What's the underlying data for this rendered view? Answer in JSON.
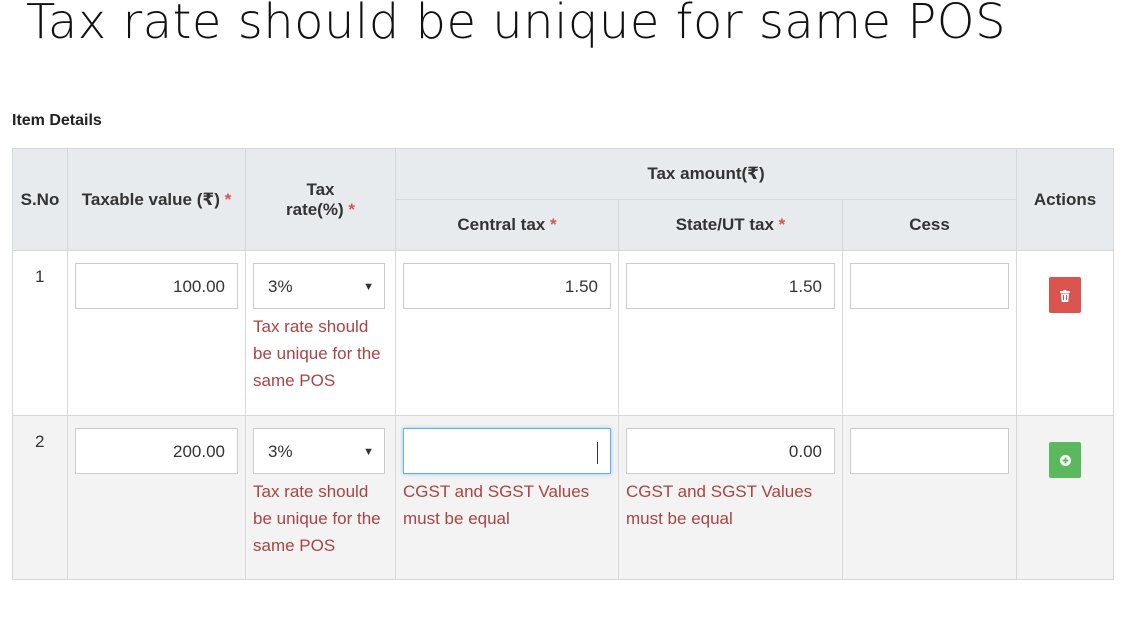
{
  "slide": {
    "title": "Tax rate should be unique for same POS"
  },
  "section": {
    "title": "Item Details"
  },
  "table": {
    "headers": {
      "sno": "S.No",
      "taxable": "Taxable value (₹)",
      "tax_rate_line1": "Tax",
      "tax_rate_line2": "rate(%)",
      "tax_amount": "Tax amount(₹)",
      "central": "Central tax",
      "state": "State/UT tax",
      "cess": "Cess",
      "actions": "Actions",
      "required_mark": "*"
    },
    "rows": [
      {
        "sno": "1",
        "taxable": "100.00",
        "tax_rate": "3%",
        "tax_rate_error": "Tax rate should be unique for the same POS",
        "central": "1.50",
        "central_error": "",
        "state": "1.50",
        "state_error": "",
        "cess": "",
        "action": "delete"
      },
      {
        "sno": "2",
        "taxable": "200.00",
        "tax_rate": "3%",
        "tax_rate_error": "Tax rate should be unique for the same POS",
        "central": "",
        "central_error": "CGST and SGST Values must be equal",
        "state": "0.00",
        "state_error": "CGST and SGST Values must be equal",
        "cess": "",
        "action": "add"
      }
    ]
  },
  "icons": {
    "delete": "trash-icon",
    "add": "plus-circle-icon"
  },
  "colors": {
    "required": "#d9534f",
    "error": "#a94442",
    "delete": "#d9534f",
    "add": "#5cb85c",
    "header_bg": "#e8ebee"
  }
}
